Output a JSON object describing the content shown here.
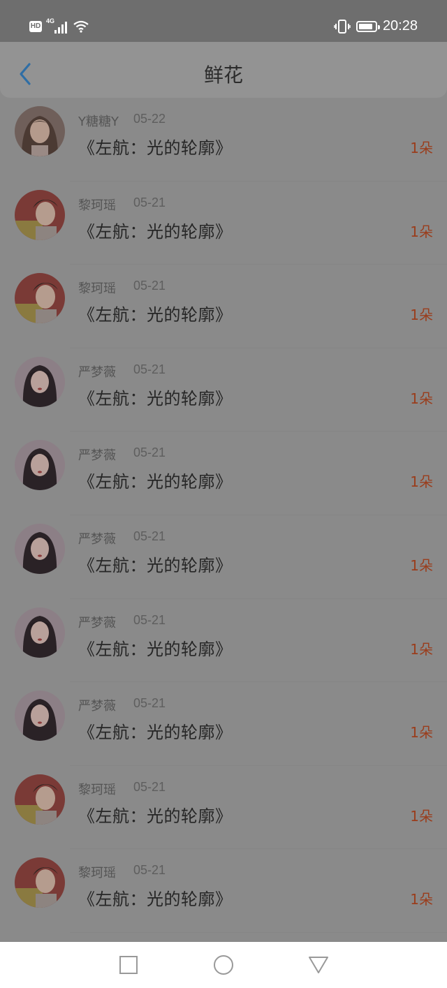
{
  "status_bar": {
    "hd": "HD",
    "network": "4G",
    "time": "20:28",
    "icons": [
      "signal-icon",
      "wifi-icon",
      "vibrate-icon",
      "battery-icon"
    ],
    "battery_level": 0.85
  },
  "header": {
    "title": "鲜花",
    "back_icon": "chevron-left-icon",
    "back_color": "#2f6ea5"
  },
  "items": [
    {
      "name": "Y糖糖Y",
      "date": "05-22",
      "book": "《左航：光的轮廓》",
      "count": "1朵",
      "avatar": "girl-a"
    },
    {
      "name": "黎珂瑶",
      "date": "05-21",
      "book": "《左航：光的轮廓》",
      "count": "1朵",
      "avatar": "boy"
    },
    {
      "name": "黎珂瑶",
      "date": "05-21",
      "book": "《左航：光的轮廓》",
      "count": "1朵",
      "avatar": "boy"
    },
    {
      "name": "严梦薇",
      "date": "05-21",
      "book": "《左航：光的轮廓》",
      "count": "1朵",
      "avatar": "girl-b"
    },
    {
      "name": "严梦薇",
      "date": "05-21",
      "book": "《左航：光的轮廓》",
      "count": "1朵",
      "avatar": "girl-b"
    },
    {
      "name": "严梦薇",
      "date": "05-21",
      "book": "《左航：光的轮廓》",
      "count": "1朵",
      "avatar": "girl-b"
    },
    {
      "name": "严梦薇",
      "date": "05-21",
      "book": "《左航：光的轮廓》",
      "count": "1朵",
      "avatar": "girl-b"
    },
    {
      "name": "严梦薇",
      "date": "05-21",
      "book": "《左航：光的轮廓》",
      "count": "1朵",
      "avatar": "girl-b"
    },
    {
      "name": "黎珂瑶",
      "date": "05-21",
      "book": "《左航：光的轮廓》",
      "count": "1朵",
      "avatar": "boy"
    },
    {
      "name": "黎珂瑶",
      "date": "05-21",
      "book": "《左航：光的轮廓》",
      "count": "1朵",
      "avatar": "boy"
    }
  ],
  "nav": {
    "icons": [
      "square-recents-icon",
      "circle-home-icon",
      "triangle-back-icon"
    ]
  },
  "colors": {
    "count": "#9a3d1c",
    "overlay": "#8a8a8a"
  }
}
